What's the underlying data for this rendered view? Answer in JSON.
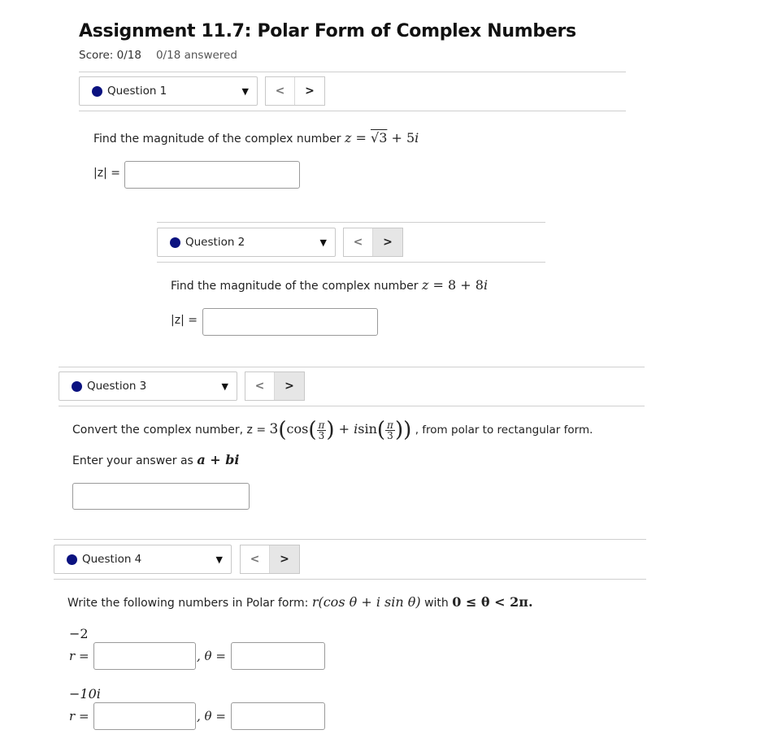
{
  "header": {
    "title": "Assignment 11.7: Polar Form of Complex Numbers",
    "score": "Score: 0/18",
    "answered": "0/18 answered"
  },
  "nav": {
    "prev": "<",
    "next": ">",
    "caret": "▼"
  },
  "q1": {
    "label": "Question 1",
    "prompt": "Find the magnitude of the complex number",
    "expr_z": "z",
    "expr_eq": " = ",
    "expr_sqrt": "√3",
    "expr_rest": " + 5",
    "expr_i": "i",
    "answer_label": "|z| =",
    "answer_value": ""
  },
  "q2": {
    "label": "Question 2",
    "prompt": "Find the magnitude of the complex number",
    "expr_z": "z",
    "expr_rest": " = 8 + 8",
    "expr_i": "i",
    "answer_label": "|z| =",
    "answer_value": ""
  },
  "q3": {
    "label": "Question 3",
    "prompt_start": "Convert the complex number, z =",
    "coef": "3",
    "cos": "cos",
    "plus": " + ",
    "i": "i",
    "sin": "sin",
    "pi": "π",
    "three": "3",
    "prompt_end": ", from polar to rectangular form.",
    "enter_text": "Enter your answer as",
    "enter_math": "a + bi",
    "answer_value": ""
  },
  "q4": {
    "label": "Question 4",
    "prompt_start": "Write the following numbers in Polar form:",
    "form": "r(cos θ + i sin θ)",
    "with": "with",
    "range": "0 ≤ θ < 2π.",
    "items": [
      {
        "number": "−2",
        "r_label": "r =",
        "theta_label": ", θ =",
        "r_value": "",
        "theta_value": ""
      },
      {
        "number": "−10i",
        "r_label": "r =",
        "theta_label": ", θ =",
        "r_value": "",
        "theta_value": ""
      }
    ]
  }
}
